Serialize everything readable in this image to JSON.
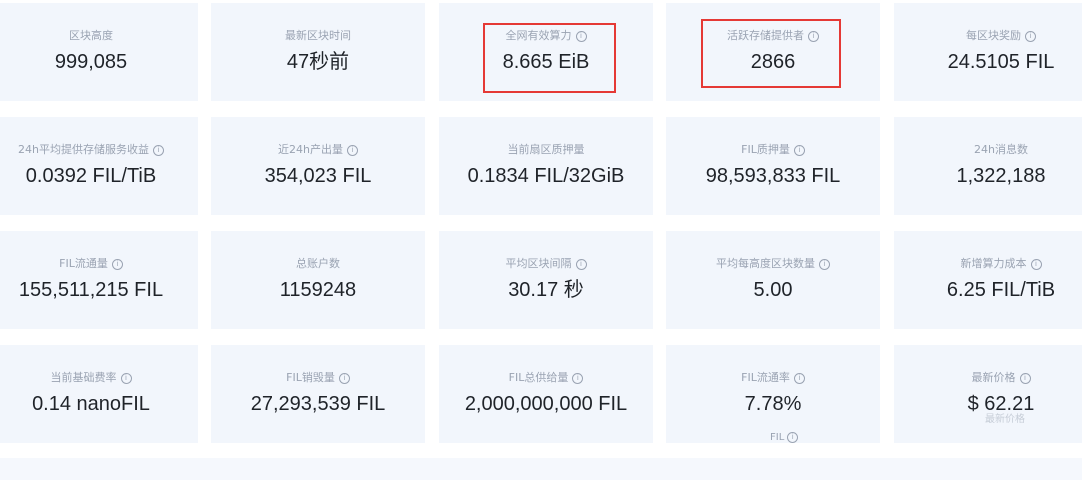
{
  "cards": [
    {
      "label": "区块高度",
      "value": "999,085",
      "info": false
    },
    {
      "label": "最新区块时间",
      "value": "47秒前",
      "info": false
    },
    {
      "label": "全网有效算力",
      "value": "8.665 EiB",
      "info": true
    },
    {
      "label": "活跃存储提供者",
      "value": "2866",
      "info": true
    },
    {
      "label": "每区块奖励",
      "value": "24.5105 FIL",
      "info": true
    },
    {
      "label": "24h平均提供存储服务收益",
      "value": "0.0392 FIL/TiB",
      "info": true
    },
    {
      "label": "近24h产出量",
      "value": "354,023 FIL",
      "info": true
    },
    {
      "label": "当前扇区质押量",
      "value": "0.1834 FIL/32GiB",
      "info": false
    },
    {
      "label": "FIL质押量",
      "value": "98,593,833 FIL",
      "info": true
    },
    {
      "label": "24h消息数",
      "value": "1,322,188",
      "info": false
    },
    {
      "label": "FIL流通量",
      "value": "155,511,215 FIL",
      "info": true
    },
    {
      "label": "总账户数",
      "value": "1159248",
      "info": false
    },
    {
      "label": "平均区块间隔",
      "value": "30.17 秒",
      "info": true
    },
    {
      "label": "平均每高度区块数量",
      "value": "5.00",
      "info": true
    },
    {
      "label": "新增算力成本",
      "value": "6.25 FIL/TiB",
      "info": true
    },
    {
      "label": "当前基础费率",
      "value": "0.14 nanoFIL",
      "info": true
    },
    {
      "label": "FIL销毁量",
      "value": "27,293,539 FIL",
      "info": true
    },
    {
      "label": "FIL总供给量",
      "value": "2,000,000,000 FIL",
      "info": true
    },
    {
      "label": "FIL流通率",
      "value": "7.78%",
      "info": true
    },
    {
      "label": "最新价格",
      "value": "$ 62.21",
      "info": true
    }
  ],
  "extra": {
    "fil_label": "FIL",
    "price_sub_label": "最新价格"
  },
  "colors": {
    "card_bg": "#f2f6fc",
    "highlight": "#e53935",
    "label": "#9aa3b2",
    "value": "#1f2329"
  },
  "icons": {
    "info": "info-icon"
  }
}
